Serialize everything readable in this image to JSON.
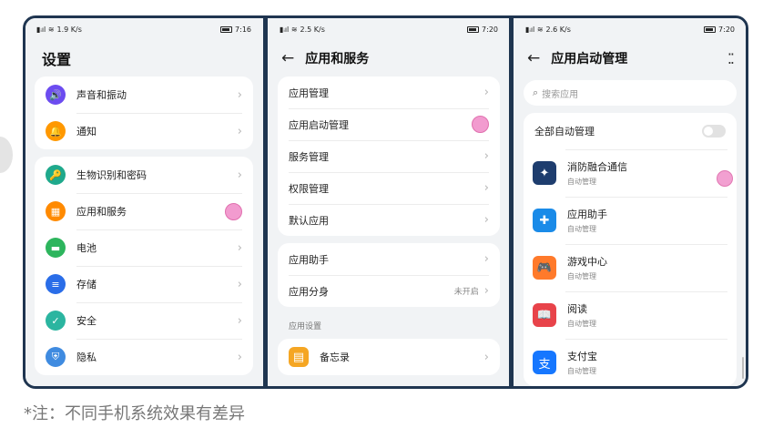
{
  "screen1": {
    "time": "7:16",
    "net_speed": "1.9 K/s",
    "title": "设置",
    "group1": [
      {
        "label": "声音和振动",
        "icon": "speaker-icon",
        "glyph": "🔊",
        "color": "#6c4cf0"
      },
      {
        "label": "通知",
        "icon": "bell-icon",
        "glyph": "🔔",
        "color": "#ff9800"
      }
    ],
    "group2": [
      {
        "label": "生物识别和密码",
        "icon": "key-icon",
        "glyph": "🔑",
        "color": "#1fa98c"
      },
      {
        "label": "应用和服务",
        "icon": "apps-icon",
        "glyph": "▦",
        "color": "#ff8a00"
      },
      {
        "label": "电池",
        "icon": "battery-icon",
        "glyph": "▬",
        "color": "#2db55d"
      },
      {
        "label": "存储",
        "icon": "storage-icon",
        "glyph": "≡",
        "color": "#2a6de8"
      },
      {
        "label": "安全",
        "icon": "shield-check-icon",
        "glyph": "✓",
        "color": "#2bb5a0"
      },
      {
        "label": "隐私",
        "icon": "privacy-icon",
        "glyph": "⛨",
        "color": "#3f8be0"
      }
    ]
  },
  "screen2": {
    "time": "7:20",
    "net_speed": "2.5 K/s",
    "title": "应用和服务",
    "group1": [
      "应用管理",
      "应用启动管理",
      "服务管理",
      "权限管理",
      "默认应用"
    ],
    "group2": [
      {
        "label": "应用助手",
        "value": ""
      },
      {
        "label": "应用分身",
        "value": "未开启"
      }
    ],
    "section_label": "应用设置",
    "memo": "备忘录"
  },
  "screen3": {
    "time": "7:20",
    "net_speed": "2.6 K/s",
    "title": "应用启动管理",
    "search_placeholder": "搜索应用",
    "all_auto": "全部自动管理",
    "apps": [
      {
        "name": "消防融合通信",
        "sub": "自动管理",
        "icon": "fire-badge-icon",
        "glyph": "✦",
        "color": "#1e3d6e"
      },
      {
        "name": "应用助手",
        "sub": "自动管理",
        "icon": "app-assistant-icon",
        "glyph": "✚",
        "color": "#1a8be8"
      },
      {
        "name": "游戏中心",
        "sub": "自动管理",
        "icon": "gamepad-icon",
        "glyph": "🎮",
        "color": "#ff7a2b"
      },
      {
        "name": "阅读",
        "sub": "自动管理",
        "icon": "book-icon",
        "glyph": "📖",
        "color": "#e8434a"
      },
      {
        "name": "支付宝",
        "sub": "自动管理",
        "icon": "alipay-icon",
        "glyph": "支",
        "color": "#1677ff"
      }
    ]
  },
  "note": "*注：不同手机系统效果有差异"
}
